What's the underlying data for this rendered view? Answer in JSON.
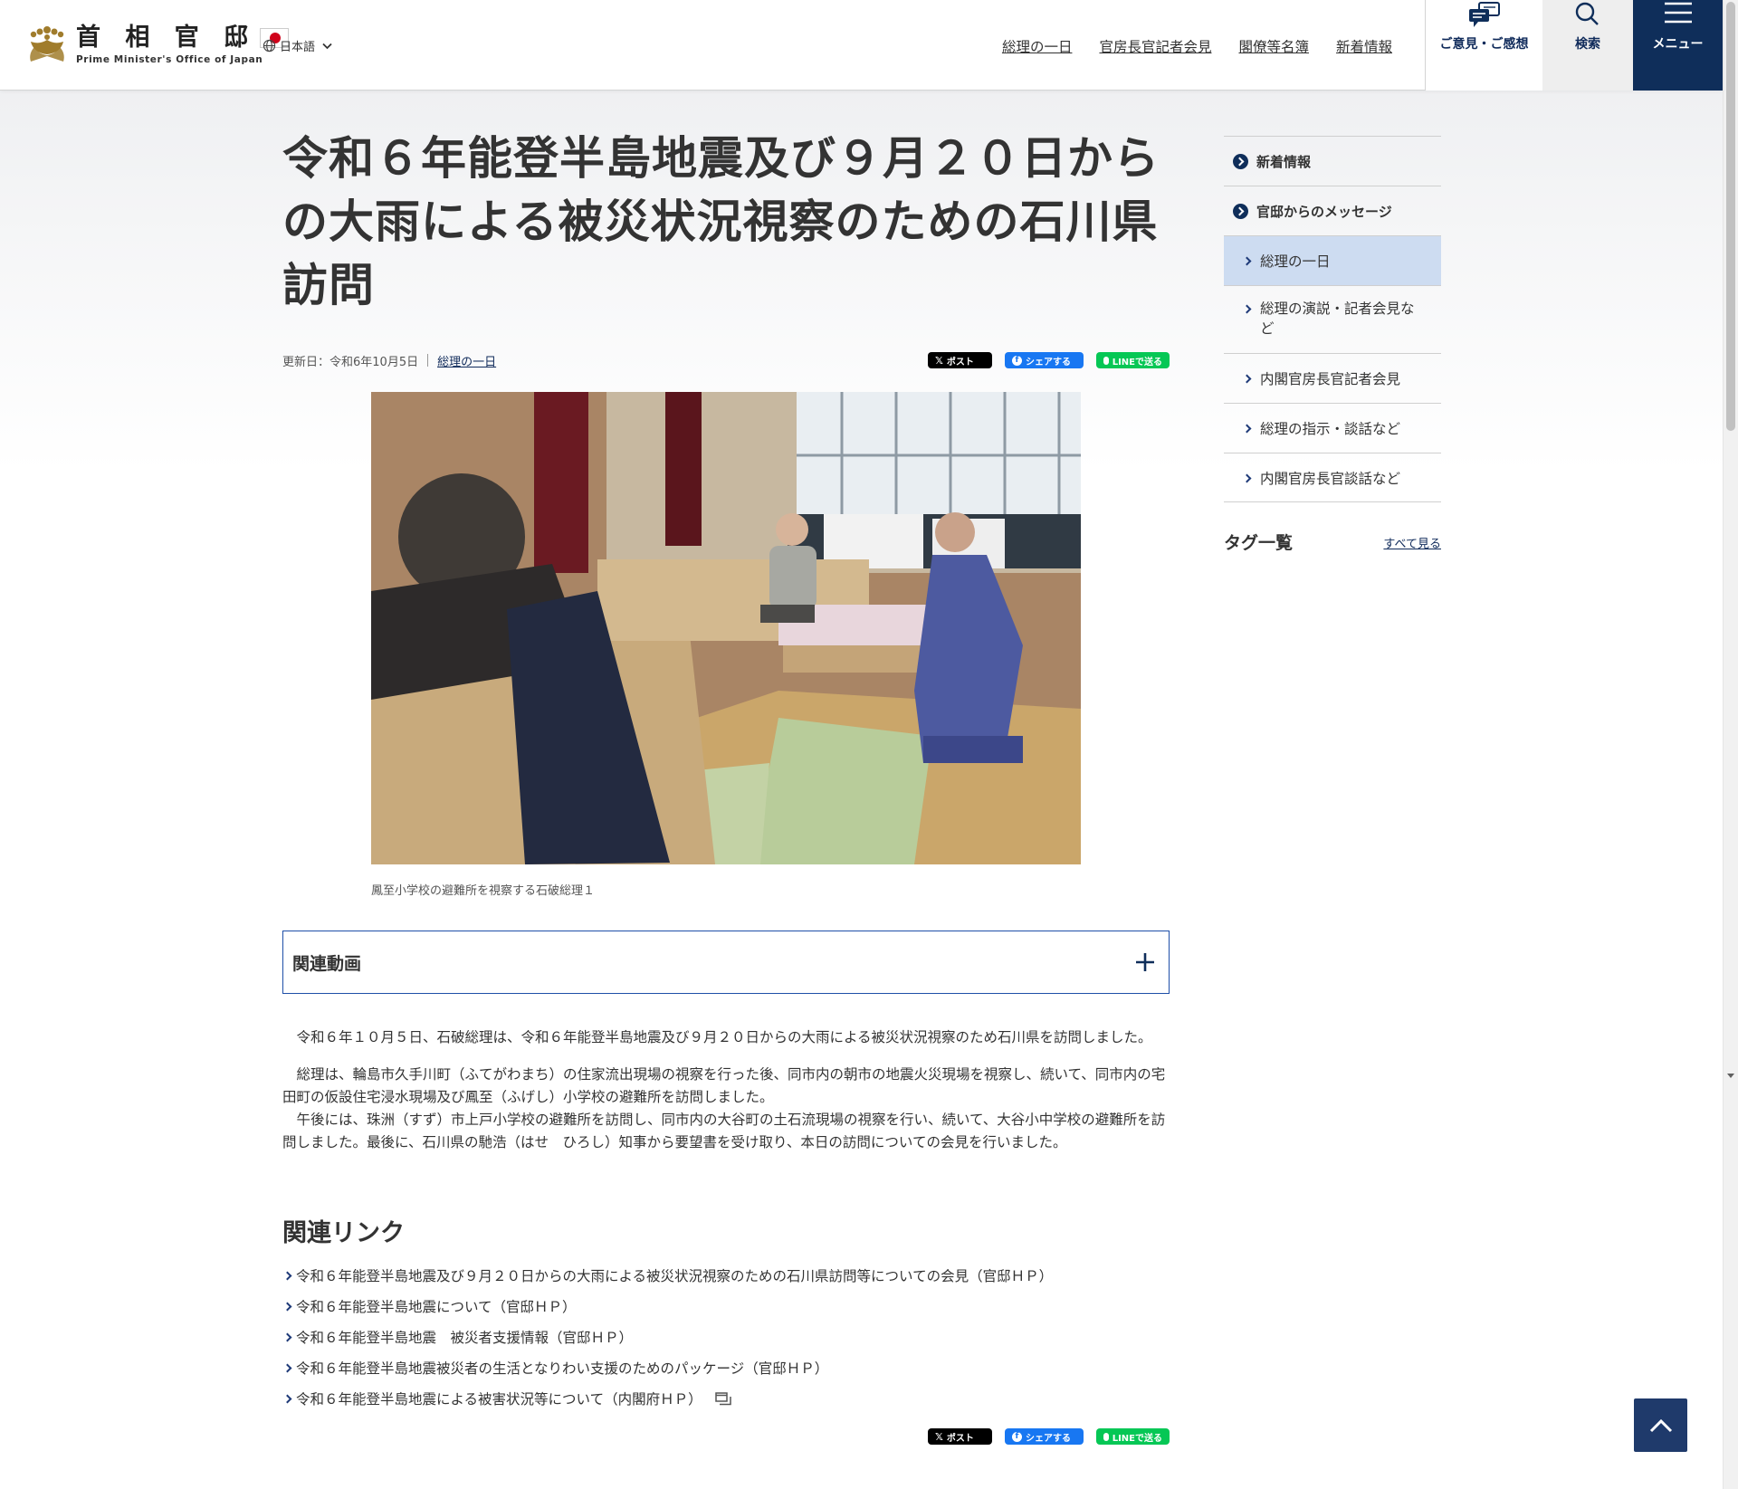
{
  "header": {
    "logo_jp": "首 相 官 邸",
    "logo_en": "Prime Minister's Office of Japan",
    "language": "日本語",
    "nav": [
      "総理の一日",
      "官房長官記者会見",
      "閣僚等名簿",
      "新着情報"
    ],
    "feedback_label": "ご意見・ご感想",
    "search_label": "検索",
    "menu_label": "メニュー"
  },
  "article": {
    "title": "令和６年能登半島地震及び９月２０日からの大雨による被災状況視察のための石川県訪問",
    "updated": "更新日：令和6年10月5日",
    "category": "総理の一日",
    "share": {
      "x": "ポスト",
      "facebook": "シェアする",
      "line": "LINEで送る"
    },
    "photo_caption": "鳳至小学校の避難所を視察する石破総理１",
    "accordion_label": "関連動画",
    "paragraphs": [
      "令和６年１０月５日、石破総理は、令和６年能登半島地震及び９月２０日からの大雨による被災状況視察のため石川県を訪問しました。",
      "総理は、輪島市久手川町（ふてがわまち）の住家流出現場の視察を行った後、同市内の朝市の地震火災現場を視察し、続いて、同市内の宅田町の仮設住宅浸水現場及び鳳至（ふげし）小学校の避難所を訪問しました。",
      "午後には、珠洲（すず）市上戸小学校の避難所を訪問し、同市内の大谷町の土石流現場の視察を行い、続いて、大谷小中学校の避難所を訪問しました。最後に、石川県の馳浩（はせ　ひろし）知事から要望書を受け取り、本日の訪問についての会見を行いました。"
    ],
    "related_links_heading": "関連リンク",
    "related_links": [
      "令和６年能登半島地震及び９月２０日からの大雨による被災状況視察のための石川県訪問等についての会見（官邸ＨＰ）",
      "令和６年能登半島地震について（官邸ＨＰ）",
      "令和６年能登半島地震　被災者支援情報（官邸ＨＰ）",
      "令和６年能登半島地震被災者の生活となりわい支援のためのパッケージ（官邸ＨＰ）",
      "令和６年能登半島地震による被害状況等について（内閣府ＨＰ）"
    ]
  },
  "sidebar": {
    "items": [
      {
        "label": "新着情報",
        "level": "top"
      },
      {
        "label": "官邸からのメッセージ",
        "level": "top"
      },
      {
        "label": "総理の一日",
        "level": "sub",
        "active": true
      },
      {
        "label": "総理の演説・記者会見など",
        "level": "sub"
      },
      {
        "label": "内閣官房長官記者会見",
        "level": "sub"
      },
      {
        "label": "総理の指示・談話など",
        "level": "sub"
      },
      {
        "label": "内閣官房長官談話など",
        "level": "sub"
      }
    ],
    "tags_heading": "タグ一覧",
    "tags_all": "すべて見る"
  },
  "colors": {
    "navy": "#0f2e5a",
    "active_bg": "#cddcf1",
    "accordion_border": "#1e4fa8",
    "x": "#000000",
    "facebook": "#1877f2",
    "line": "#06c755"
  },
  "icons": [
    "emblem-icon",
    "flag-icon",
    "globe-icon",
    "chevron-down-icon",
    "feedback-icon",
    "search-icon",
    "hamburger-icon",
    "plus-icon",
    "chevron-right-icon",
    "external-window-icon",
    "arrow-up-icon"
  ]
}
